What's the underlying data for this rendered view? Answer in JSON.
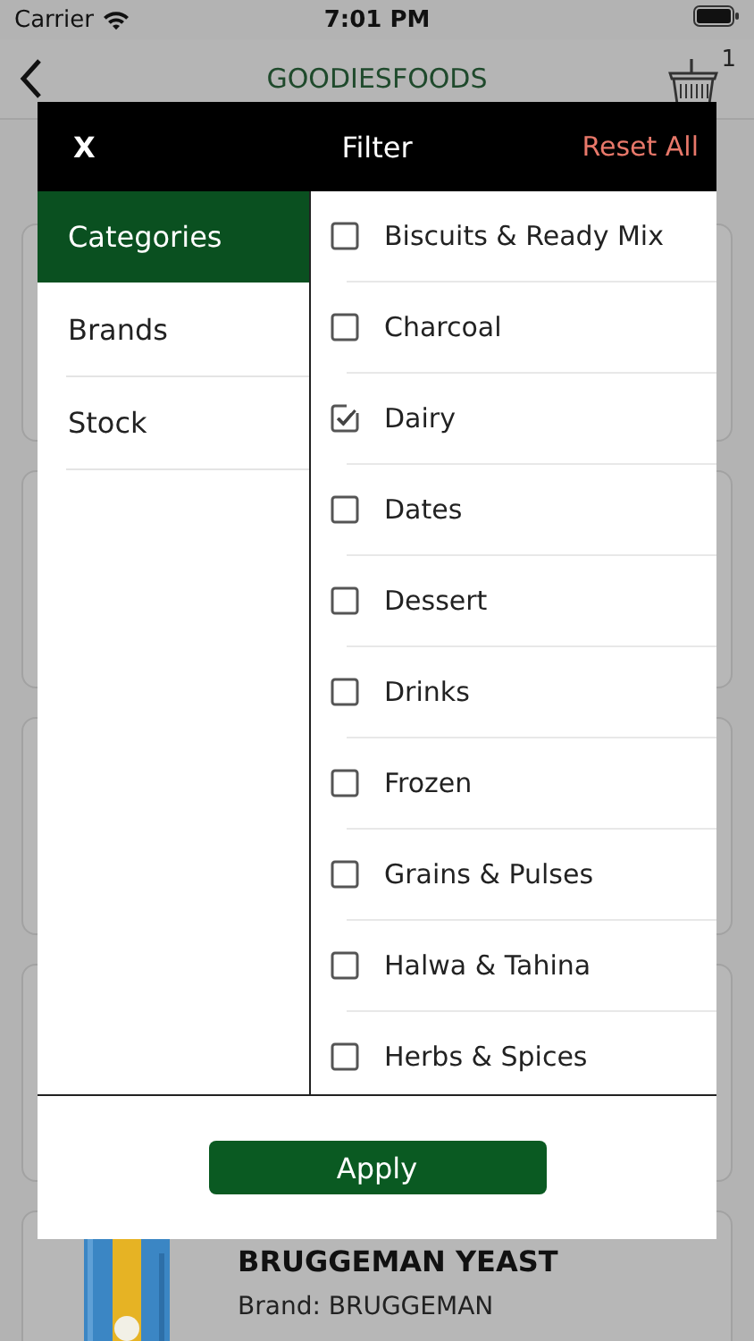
{
  "status_bar": {
    "carrier": "Carrier",
    "time": "7:01 PM"
  },
  "nav_bar": {
    "title": "GOODIESFOODS",
    "cart_count": "1"
  },
  "background_cards": [
    {
      "kind": "empty"
    },
    {
      "kind": "empty"
    },
    {
      "kind": "empty"
    },
    {
      "kind": "empty"
    },
    {
      "kind": "product",
      "name": "BRUGGEMAN YEAST",
      "brand": "Brand:  BRUGGEMAN"
    }
  ],
  "filter": {
    "close": "X",
    "title": "Filter",
    "reset": "Reset All",
    "groups": [
      {
        "label": "Categories",
        "selected": true
      },
      {
        "label": "Brands",
        "selected": false
      },
      {
        "label": "Stock",
        "selected": false
      }
    ],
    "options": [
      {
        "label": "Biscuits & Ready Mix",
        "checked": false
      },
      {
        "label": "Charcoal",
        "checked": false
      },
      {
        "label": "Dairy",
        "checked": true
      },
      {
        "label": "Dates",
        "checked": false
      },
      {
        "label": "Dessert",
        "checked": false
      },
      {
        "label": "Drinks",
        "checked": false
      },
      {
        "label": "Frozen",
        "checked": false
      },
      {
        "label": "Grains & Pulses",
        "checked": false
      },
      {
        "label": "Halwa & Tahina",
        "checked": false
      },
      {
        "label": "Herbs & Spices",
        "checked": false
      }
    ],
    "apply": "Apply"
  }
}
